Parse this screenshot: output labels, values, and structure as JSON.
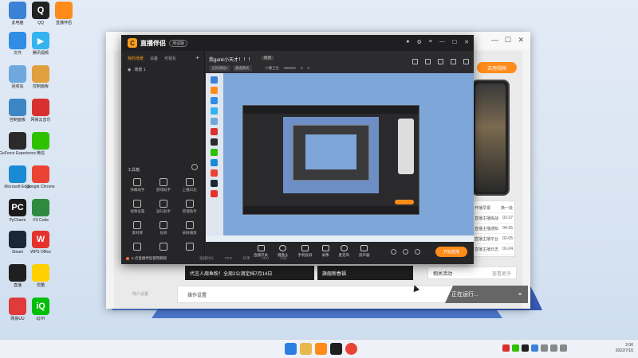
{
  "desktop_icons": [
    {
      "label": "此电脑",
      "color": "#3b82d6",
      "glyph": ""
    },
    {
      "label": "QQ",
      "color": "#222222",
      "glyph": "Q"
    },
    {
      "label": "直播伴侣",
      "color": "#ff8c1a",
      "glyph": ""
    },
    {
      "label": "文件",
      "color": "#2f8de4",
      "glyph": ""
    },
    {
      "label": "腾讯视频",
      "color": "#35b3f0",
      "glyph": "▶"
    },
    {
      "label": "回收站",
      "color": "#6fa8dc",
      "glyph": ""
    },
    {
      "label": "控制面板",
      "color": "#e0a040",
      "glyph": ""
    },
    {
      "label": "控制面板",
      "color": "#3d86c6",
      "glyph": ""
    },
    {
      "label": "网易云音乐",
      "color": "#d8302f",
      "glyph": ""
    },
    {
      "label": "GeForce Experience",
      "color": "#2a2a2a",
      "glyph": ""
    },
    {
      "label": "微信",
      "color": "#2dc100",
      "glyph": ""
    },
    {
      "label": "Microsoft Edge",
      "color": "#1a8ad4",
      "glyph": ""
    },
    {
      "label": "Google Chrome",
      "color": "#ea4335",
      "glyph": ""
    },
    {
      "label": "PyCharm",
      "color": "#1b1b1b",
      "glyph": "PC"
    },
    {
      "label": "VS Code",
      "color": "#2f8a3f",
      "glyph": ""
    },
    {
      "label": "Steam",
      "color": "#1b2838",
      "glyph": ""
    },
    {
      "label": "WPS Office",
      "color": "#e5322d",
      "glyph": "W"
    },
    {
      "label": "直播",
      "color": "#1f1f1f",
      "glyph": ""
    },
    {
      "label": "优酷",
      "color": "#ffd000",
      "glyph": ""
    },
    {
      "label": "网易UU",
      "color": "#e03a3a",
      "glyph": ""
    },
    {
      "label": "iQIYI",
      "color": "#00be06",
      "glyph": "iQ"
    }
  ],
  "app": {
    "brand": "直播伴侣",
    "version": "测试版",
    "left_tabs": [
      "我的场景",
      "设备",
      "可视化"
    ],
    "scene_label": "场景 1",
    "tools_header": "工具箱",
    "tools": [
      "弹幕助手",
      "游戏助手",
      "上播日志",
      "视频设置",
      "送礼助手",
      "管理助手",
      "素材库",
      "投屏",
      "录屏播放",
      "",
      "",
      ""
    ],
    "footer_note": "5 点直播伴侣使用教程",
    "room_title": "我gank小天才！！！",
    "room_edit": "修改",
    "room_tags": [
      "全民搞起2",
      "通道模式"
    ],
    "room_meta": [
      "小槽卫生",
      "690902",
      "0",
      "0"
    ],
    "controls": [
      "直播开关",
      "摄像头",
      "手机投屏",
      "录像",
      "麦克风",
      "扬声器"
    ],
    "live_button": "开始直播",
    "stats": [
      "直播时长",
      "FPS",
      "码率",
      "CPU",
      "内存"
    ]
  },
  "browser": {
    "promo_button": "去用视频",
    "side_list": [
      {
        "label": "开播早报",
        "meta": "换一批"
      },
      {
        "label": "直播主播挑战",
        "meta": "02-27"
      },
      {
        "label": "直播主播通知",
        "meta": "04-25"
      },
      {
        "label": "直播主播平台",
        "meta": "02-05"
      },
      {
        "label": "直播主播日志",
        "meta": "01-24"
      }
    ],
    "related": {
      "label": "相关活动",
      "more": "查看更多"
    },
    "news": [
      "代言人周鱼粉！全周2公测定档7月14日",
      "旗舰新春福"
    ],
    "helper_text": "操作设置",
    "running": "正在运行...",
    "left_label": "简介设置"
  },
  "clock": {
    "time": "2:06",
    "date": "2022/7/16"
  }
}
